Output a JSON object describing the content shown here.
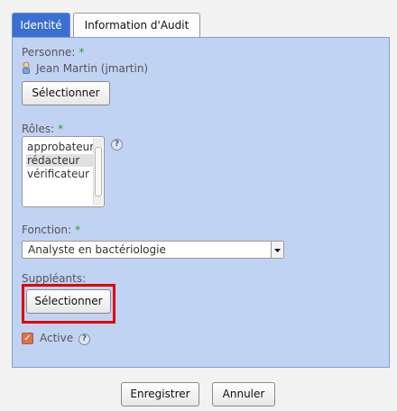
{
  "tabs": [
    {
      "label": "Identité",
      "active": true
    },
    {
      "label": "Information d'Audit",
      "active": false
    }
  ],
  "person": {
    "label": "Personne:",
    "required_mark": "*",
    "name": "Jean Martin (jmartin)",
    "select_button": "Sélectionner"
  },
  "roles": {
    "label": "Rôles:",
    "required_mark": "*",
    "options": [
      "approbateur",
      "rédacteur",
      "vérificateur"
    ],
    "selected_index": 1,
    "help": "?"
  },
  "function": {
    "label": "Fonction:",
    "required_mark": "*",
    "selected": "Analyste en bactériologie"
  },
  "substitutes": {
    "label": "Suppléants:",
    "select_button": "Sélectionner"
  },
  "active": {
    "label": "Active",
    "checked": true,
    "help": "?"
  },
  "footer": {
    "save": "Enregistrer",
    "cancel": "Annuler"
  },
  "colors": {
    "tab_active": "#3b6fd1",
    "panel_bg": "#c1d3f3",
    "required": "#2a9a2a",
    "highlight": "#e00000"
  },
  "icons": {
    "person": "user-icon",
    "help": "question-icon",
    "dropdown": "chevron-down-icon"
  }
}
